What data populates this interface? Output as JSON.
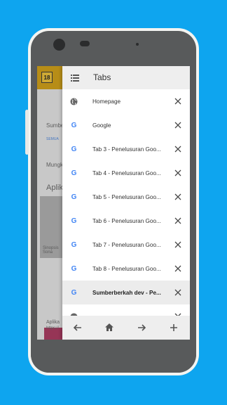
{
  "background_app": {
    "logo_text": "18",
    "text_1": "Sumber",
    "text_2": "SEMUA",
    "text_3": "Mungk",
    "text_4": "Aplik",
    "text_5": "Sinopsis Sona",
    "text_6": "Aplika",
    "text_7": "https://"
  },
  "drawer": {
    "title": "Tabs",
    "tabs": [
      {
        "label": "Homepage",
        "icon": "globe-icon"
      },
      {
        "label": "Google",
        "icon": "google-icon"
      },
      {
        "label": "Tab 3 - Penelusuran Goo...",
        "icon": "google-icon"
      },
      {
        "label": "Tab 4 - Penelusuran Goo...",
        "icon": "google-icon"
      },
      {
        "label": "Tab 5 - Penelusuran Goo...",
        "icon": "google-icon"
      },
      {
        "label": "Tab 6 - Penelusuran Goo...",
        "icon": "google-icon"
      },
      {
        "label": "Tab 7 - Penelusuran Goo...",
        "icon": "google-icon"
      },
      {
        "label": "Tab 8 - Penelusuran Goo...",
        "icon": "google-icon"
      },
      {
        "label": "Sumberberkah dev - Pe...",
        "icon": "google-icon",
        "active": true
      },
      {
        "label": "",
        "icon": "globe-icon"
      }
    ]
  },
  "bottom_nav": {
    "back": "back-arrow-icon",
    "home": "home-icon",
    "forward": "forward-arrow-icon",
    "add": "add-icon"
  },
  "colors": {
    "background": "#0ea5ef",
    "google_blue": "#4285f4",
    "active_tab": "#ececec"
  }
}
